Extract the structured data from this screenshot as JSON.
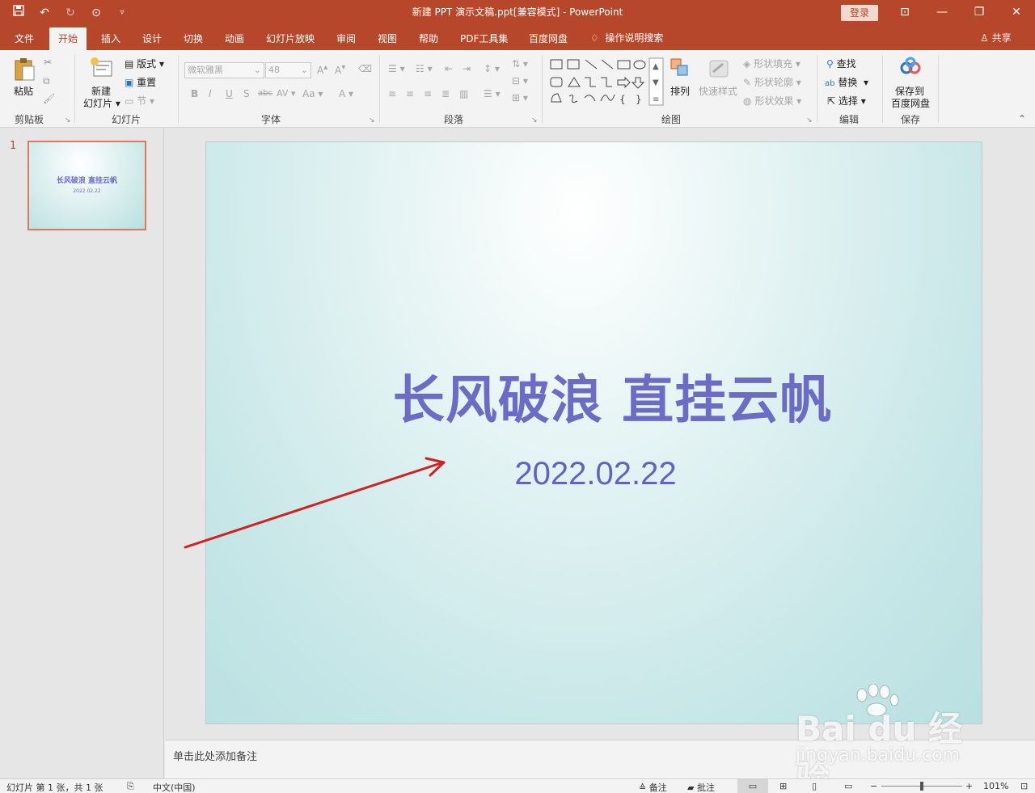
{
  "titlebar": {
    "title": "新建 PPT 演示文稿.ppt[兼容模式]  -  PowerPoint",
    "login": "登录"
  },
  "tabs": [
    "文件",
    "开始",
    "插入",
    "设计",
    "切换",
    "动画",
    "幻灯片放映",
    "审阅",
    "视图",
    "帮助",
    "PDF工具集",
    "百度网盘"
  ],
  "active_tab": "开始",
  "tellme": "操作说明搜索",
  "share": "共享",
  "ribbon": {
    "clipboard": {
      "label": "剪贴板",
      "paste": "粘贴"
    },
    "slides": {
      "label": "幻灯片",
      "new_slide_1": "新建",
      "new_slide_2": "幻灯片",
      "layout": "版式",
      "reset": "重置",
      "section": "节"
    },
    "font": {
      "label": "字体",
      "font_name": "微软雅黑",
      "font_size": "48"
    },
    "paragraph": {
      "label": "段落"
    },
    "drawing": {
      "label": "绘图",
      "arrange": "排列",
      "quick_styles": "快速样式",
      "shape_fill": "形状填充",
      "shape_outline": "形状轮廓",
      "shape_effects": "形状效果"
    },
    "editing": {
      "label": "编辑",
      "find": "查找",
      "replace": "替换",
      "select": "选择"
    },
    "save": {
      "label": "保存",
      "save_to_1": "保存到",
      "save_to_2": "百度网盘"
    }
  },
  "thumbnail": {
    "number": "1",
    "title": "长风破浪 直挂云帆",
    "subtitle": "2022.02.22"
  },
  "slide": {
    "title": "长风破浪 直挂云帆",
    "subtitle": "2022.02.22"
  },
  "notes_placeholder": "单击此处添加备注",
  "watermark": {
    "logo": "Bai du 经验",
    "url": "jingyan.baidu.com"
  },
  "statusbar": {
    "slide_info": "幻灯片 第 1 张，共 1 张",
    "language": "中文(中国)",
    "notes": "备注",
    "comments": "批注",
    "zoom": "101%",
    "zoom_level_percent": 101
  },
  "colors": {
    "accent": "#b7472a",
    "title_text": "#6c6cc6",
    "annotation_arrow": "#d42020"
  }
}
